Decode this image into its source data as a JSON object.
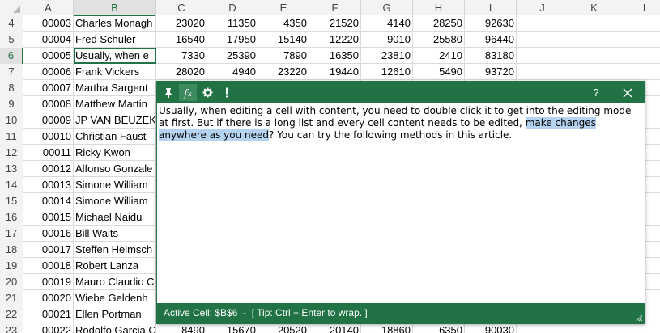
{
  "columns": [
    "A",
    "B",
    "C",
    "D",
    "E",
    "F",
    "G",
    "H",
    "I",
    "J",
    "K",
    "L"
  ],
  "active_column": "B",
  "active_row": "6",
  "rows": [
    {
      "num": "4",
      "a": "00003",
      "b": "Charles Monagh",
      "c": "23020",
      "d": "11350",
      "e": "4350",
      "f": "21520",
      "g": "4140",
      "h": "28250",
      "i": "92630"
    },
    {
      "num": "5",
      "a": "00004",
      "b": "Fred Schuler",
      "c": "16540",
      "d": "17950",
      "e": "15140",
      "f": "12220",
      "g": "9010",
      "h": "25580",
      "i": "96440"
    },
    {
      "num": "6",
      "a": "00005",
      "b": "Usually, when e",
      "c": "7330",
      "d": "25390",
      "e": "7890",
      "f": "16350",
      "g": "23810",
      "h": "2410",
      "i": "83180"
    },
    {
      "num": "7",
      "a": "00006",
      "b": "Frank Vickers",
      "c": "28020",
      "d": "4940",
      "e": "23220",
      "f": "19440",
      "g": "12610",
      "h": "5490",
      "i": "93720"
    },
    {
      "num": "8",
      "a": "00007",
      "b": "Martha Sargent",
      "c": "",
      "d": "",
      "e": "",
      "f": "",
      "g": "",
      "h": "",
      "i": ""
    },
    {
      "num": "9",
      "a": "00008",
      "b": "Matthew Martin",
      "c": "",
      "d": "",
      "e": "",
      "f": "",
      "g": "",
      "h": "",
      "i": ""
    },
    {
      "num": "10",
      "a": "00009",
      "b": "JP VAN BEUZEKO",
      "c": "",
      "d": "",
      "e": "",
      "f": "",
      "g": "",
      "h": "",
      "i": ""
    },
    {
      "num": "11",
      "a": "00010",
      "b": "Christian Faust",
      "c": "",
      "d": "",
      "e": "",
      "f": "",
      "g": "",
      "h": "",
      "i": ""
    },
    {
      "num": "12",
      "a": "00011",
      "b": "Ricky Kwon",
      "c": "",
      "d": "",
      "e": "",
      "f": "",
      "g": "",
      "h": "",
      "i": ""
    },
    {
      "num": "13",
      "a": "00012",
      "b": "Alfonso Gonzale",
      "c": "",
      "d": "",
      "e": "",
      "f": "",
      "g": "",
      "h": "",
      "i": ""
    },
    {
      "num": "14",
      "a": "00013",
      "b": "Simone William",
      "c": "",
      "d": "",
      "e": "",
      "f": "",
      "g": "",
      "h": "",
      "i": ""
    },
    {
      "num": "15",
      "a": "00014",
      "b": "Simone William",
      "c": "",
      "d": "",
      "e": "",
      "f": "",
      "g": "",
      "h": "",
      "i": ""
    },
    {
      "num": "16",
      "a": "00015",
      "b": "Michael Naidu",
      "c": "",
      "d": "",
      "e": "",
      "f": "",
      "g": "",
      "h": "",
      "i": ""
    },
    {
      "num": "17",
      "a": "00016",
      "b": "Bill Waits",
      "c": "",
      "d": "",
      "e": "",
      "f": "",
      "g": "",
      "h": "",
      "i": ""
    },
    {
      "num": "18",
      "a": "00017",
      "b": "Steffen Helmsch",
      "c": "",
      "d": "",
      "e": "",
      "f": "",
      "g": "",
      "h": "",
      "i": ""
    },
    {
      "num": "19",
      "a": "00018",
      "b": "Robert Lanza",
      "c": "",
      "d": "",
      "e": "",
      "f": "",
      "g": "",
      "h": "",
      "i": ""
    },
    {
      "num": "20",
      "a": "00019",
      "b": "Mauro Claudio C",
      "c": "",
      "d": "",
      "e": "",
      "f": "",
      "g": "",
      "h": "",
      "i": ""
    },
    {
      "num": "21",
      "a": "00020",
      "b": "Wiebe Geldenh",
      "c": "",
      "d": "",
      "e": "",
      "f": "",
      "g": "",
      "h": "",
      "i": ""
    },
    {
      "num": "22",
      "a": "00021",
      "b": "Ellen Portman",
      "c": "",
      "d": "",
      "e": "",
      "f": "",
      "g": "",
      "h": "",
      "i": ""
    },
    {
      "num": "23",
      "a": "00022",
      "b": "Rodolfo Garcia C",
      "c": "8490",
      "d": "15670",
      "e": "20520",
      "f": "20140",
      "g": "18860",
      "h": "6350",
      "i": "90030"
    }
  ],
  "editor": {
    "toolbar": {
      "pin_icon": "pin-icon",
      "formula_icon": "fx-icon",
      "settings_icon": "gear-icon",
      "alert_icon": "exclamation-icon",
      "help_label": "?",
      "close_icon": "close-icon"
    },
    "text_before": "Usually, when editing a cell with content, you need to double click it to get into the editing mode at first. But if there is a long list and every cell content needs to be edited, ",
    "text_highlight": "make changes anywhere as you need",
    "text_after": "? You can try the following methods in this article.",
    "status": "Active Cell: $B$6  -  [ Tip: Ctrl + Enter to wrap. ]"
  },
  "colors": {
    "accent": "#217346",
    "highlight": "#b4d3f0"
  }
}
